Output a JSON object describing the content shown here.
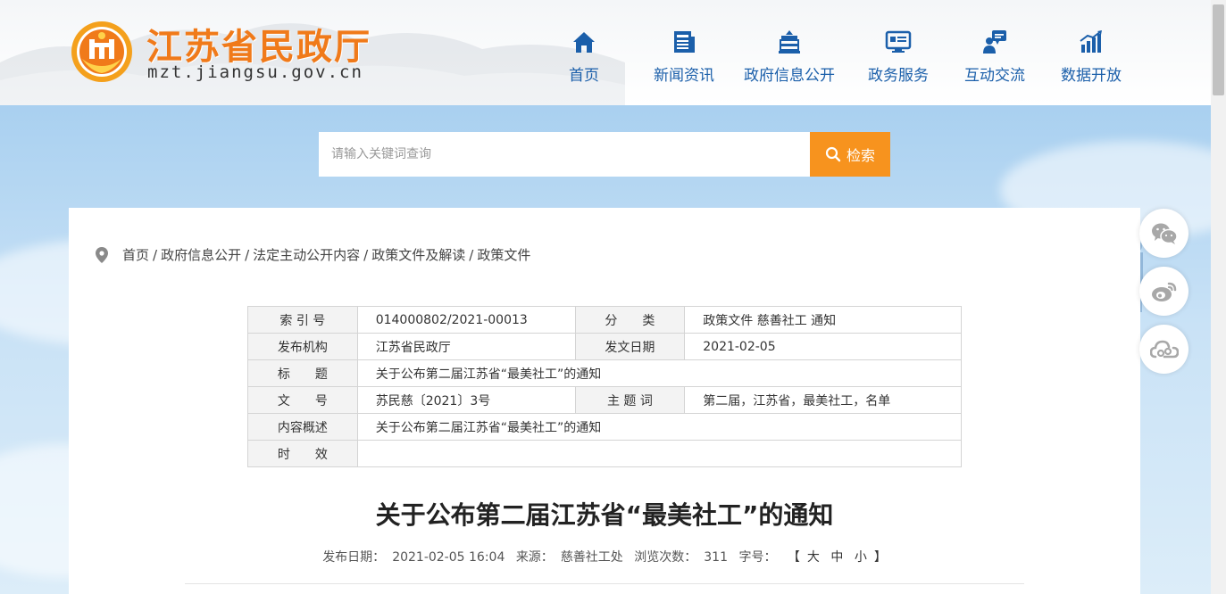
{
  "header": {
    "site_name": "江苏省民政厅",
    "site_domain": "mzt.jiangsu.gov.cn",
    "nav": [
      {
        "label": "首页",
        "icon": "home-icon"
      },
      {
        "label": "新闻资讯",
        "icon": "news-icon"
      },
      {
        "label": "政府信息公开",
        "icon": "government-building-icon"
      },
      {
        "label": "政务服务",
        "icon": "service-monitor-icon"
      },
      {
        "label": "互动交流",
        "icon": "interaction-icon"
      },
      {
        "label": "数据开放",
        "icon": "data-chart-icon"
      }
    ]
  },
  "search": {
    "placeholder": "请输入关键词查询",
    "button_label": "检索"
  },
  "breadcrumb": [
    "首页",
    "政府信息公开",
    "法定主动公开内容",
    "政策文件及解读",
    "政策文件"
  ],
  "meta_table": {
    "rows": [
      {
        "k1": "索 引 号",
        "v1": "014000802/2021-00013",
        "k2": "分　　类",
        "v2": "政策文件 慈善社工 通知"
      },
      {
        "k1": "发布机构",
        "v1": "江苏省民政厅",
        "k2": "发文日期",
        "v2": "2021-02-05"
      },
      {
        "k1": "标　　题",
        "v": "关于公布第二届江苏省“最美社工”的通知"
      },
      {
        "k1": "文　　号",
        "v1": "苏民慈〔2021〕3号",
        "k2": "主 题 词",
        "v2": "第二届，江苏省，最美社工，名单"
      },
      {
        "k1": "内容概述",
        "v": "关于公布第二届江苏省“最美社工”的通知"
      },
      {
        "k1": "时　　效",
        "v": ""
      }
    ]
  },
  "article": {
    "title": "关于公布第二届江苏省“最美社工”的通知",
    "date_label": "发布日期：",
    "date": "2021-02-05 16:04",
    "source_label": "来源：",
    "source": "慈善社工处",
    "views_label": "浏览次数：",
    "views": "311",
    "font_label": "字号：",
    "font_open": "【",
    "font_large": "大",
    "font_medium": "中",
    "font_small": "小",
    "font_close": "】"
  },
  "share": [
    {
      "icon": "wechat-icon"
    },
    {
      "icon": "weibo-icon"
    },
    {
      "icon": "share-link-icon"
    }
  ],
  "colors": {
    "brand_orange": "#f07a1a",
    "nav_blue": "#1b5faa",
    "search_orange": "#f7931e"
  }
}
